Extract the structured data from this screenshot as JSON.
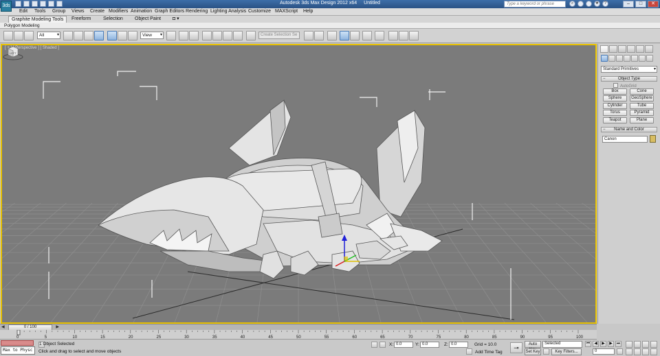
{
  "app": {
    "logo_text": "3ds",
    "title": "Autodesk 3ds Max Design 2012 x64",
    "doc_name": "Untitled",
    "search_placeholder": "Type a keyword or phrase"
  },
  "menu": [
    "Edit",
    "Tools",
    "Group",
    "Views",
    "Create",
    "Modifiers",
    "Animation",
    "Graph Editors",
    "Rendering",
    "Lighting Analysis",
    "Customize",
    "MAXScript",
    "Help"
  ],
  "ribbon": {
    "tabs": [
      "Graphite Modeling Tools",
      "Freeform",
      "Selection",
      "Object Paint"
    ],
    "extra": "◘ ▾",
    "panel_label": "Polygon Modeling"
  },
  "toolbar": {
    "filter": "All",
    "ref_coord": "View",
    "selection_set_placeholder": "Create Selection Se"
  },
  "viewport": {
    "label": "[ + ] [ Perspective ] [ Shaded ]",
    "cube_label": "LEFT"
  },
  "command_panel": {
    "dropdown": "Standard Primitives",
    "object_type_title": "Object Type",
    "autogrid": "AutoGrid",
    "primitives": [
      "Box",
      "Cone",
      "Sphere",
      "GeoSphere",
      "Cylinder",
      "Tube",
      "Torus",
      "Pyramid",
      "Teapot",
      "Plane"
    ],
    "name_color_title": "Name and Color",
    "object_name": "Canon"
  },
  "timeline": {
    "frame_label": "0 / 100",
    "ticks": [
      0,
      5,
      10,
      15,
      20,
      25,
      30,
      35,
      40,
      45,
      50,
      55,
      60,
      65,
      70,
      75,
      80,
      85,
      90,
      95,
      100
    ]
  },
  "status": {
    "maxscript": "Max to Physc",
    "selected_count": "1 Object Selected",
    "prompt": "Click and drag to select and move objects",
    "x_label": "X:",
    "x_value": "0.0",
    "y_label": "Y:",
    "y_value": "0.0",
    "z_label": "Z:",
    "z_value": "0.0",
    "grid": "Grid = 10.0",
    "add_time_tag": "Add Time Tag",
    "auto_key": "Auto Key",
    "selected_dd": "Selected",
    "set_key": "Set Key",
    "key_filters": "Key Filters...",
    "current_frame": "0"
  }
}
